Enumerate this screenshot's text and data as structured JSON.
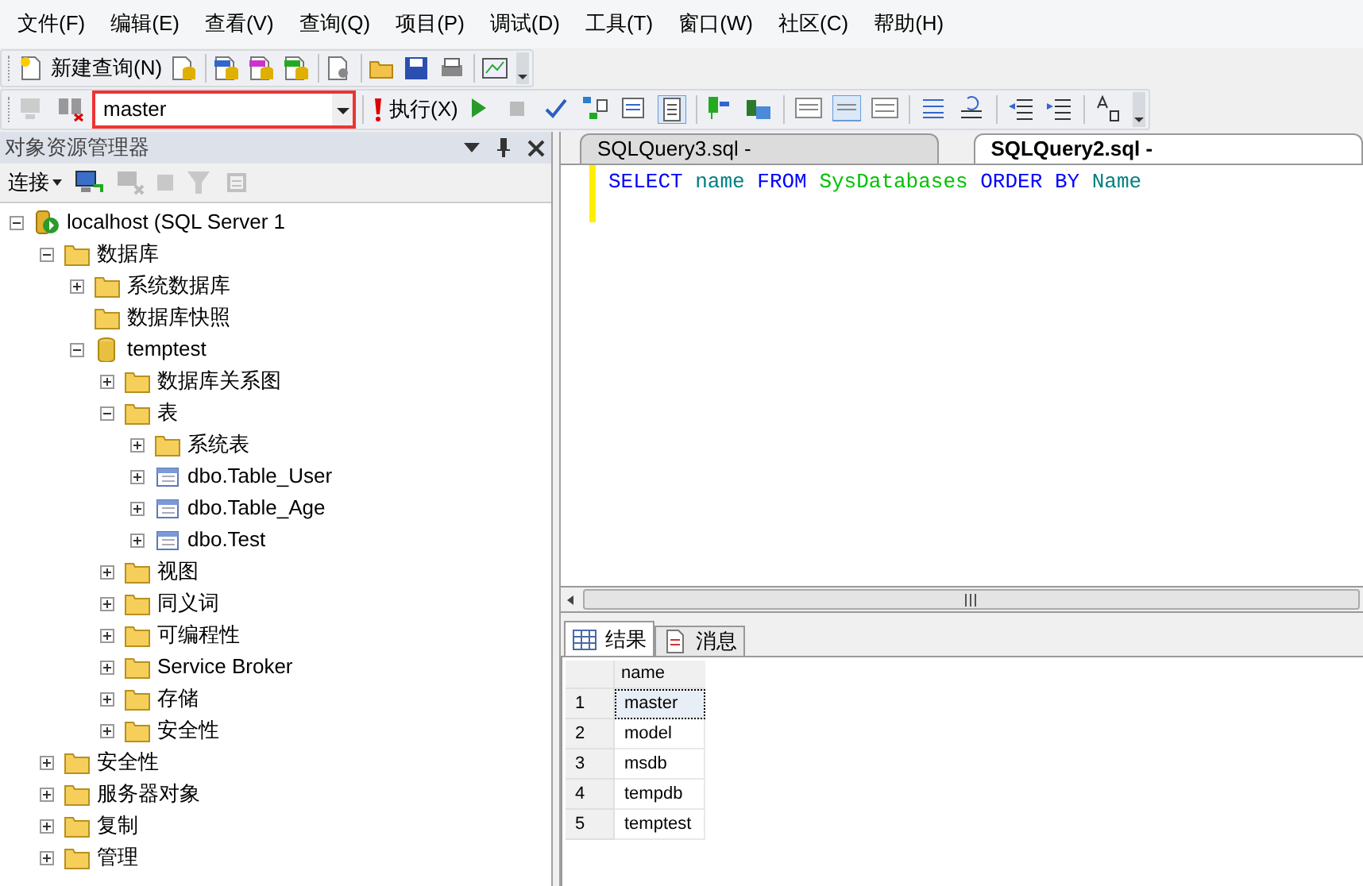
{
  "menu": [
    "文件(F)",
    "编辑(E)",
    "查看(V)",
    "查询(Q)",
    "项目(P)",
    "调试(D)",
    "工具(T)",
    "窗口(W)",
    "社区(C)",
    "帮助(H)"
  ],
  "toolbar": {
    "new_query": "新建查询(N)"
  },
  "sql_toolbar": {
    "database": "master",
    "highlighted": true,
    "execute": "执行(X)"
  },
  "object_explorer": {
    "title": "对象资源管理器",
    "connect": "连接",
    "tree": [
      {
        "label": "localhost (SQL Server 1",
        "kind": "server",
        "expanded": true,
        "children": [
          {
            "label": "数据库",
            "kind": "folder",
            "expanded": true,
            "children": [
              {
                "label": "系统数据库",
                "kind": "folder",
                "expanded": false
              },
              {
                "label": "数据库快照",
                "kind": "folder"
              },
              {
                "label": "temptest",
                "kind": "database",
                "expanded": true,
                "children": [
                  {
                    "label": "数据库关系图",
                    "kind": "folder",
                    "expanded": false
                  },
                  {
                    "label": "表",
                    "kind": "folder",
                    "expanded": true,
                    "children": [
                      {
                        "label": "系统表",
                        "kind": "folder",
                        "expanded": false
                      },
                      {
                        "label": "dbo.Table_User",
                        "kind": "table",
                        "expanded": false
                      },
                      {
                        "label": "dbo.Table_Age",
                        "kind": "table",
                        "expanded": false
                      },
                      {
                        "label": "dbo.Test",
                        "kind": "table",
                        "expanded": false
                      }
                    ]
                  },
                  {
                    "label": "视图",
                    "kind": "folder",
                    "expanded": false
                  },
                  {
                    "label": "同义词",
                    "kind": "folder",
                    "expanded": false
                  },
                  {
                    "label": "可编程性",
                    "kind": "folder",
                    "expanded": false
                  },
                  {
                    "label": "Service Broker",
                    "kind": "folder",
                    "expanded": false
                  },
                  {
                    "label": "存储",
                    "kind": "folder",
                    "expanded": false
                  },
                  {
                    "label": "安全性",
                    "kind": "folder",
                    "expanded": false
                  }
                ]
              }
            ]
          },
          {
            "label": "安全性",
            "kind": "folder",
            "expanded": false
          },
          {
            "label": "服务器对象",
            "kind": "folder",
            "expanded": false
          },
          {
            "label": "复制",
            "kind": "folder",
            "expanded": false
          },
          {
            "label": "管理",
            "kind": "folder",
            "expanded": false
          }
        ]
      }
    ]
  },
  "editor_tabs": [
    {
      "label": "SQLQuery3.sql -",
      "selected": false
    },
    {
      "label": "SQLQuery2.sql -",
      "selected": true
    }
  ],
  "code": [
    {
      "text": "SELECT",
      "kind": "keyword"
    },
    {
      "text": "name",
      "kind": "identifier"
    },
    {
      "text": "FROM",
      "kind": "keyword"
    },
    {
      "text": "SysDatabases",
      "kind": "object"
    },
    {
      "text": "ORDER",
      "kind": "keyword"
    },
    {
      "text": "BY",
      "kind": "keyword"
    },
    {
      "text": "Name",
      "kind": "identifier"
    }
  ],
  "result_tabs": [
    {
      "label": "结果",
      "kind": "grid",
      "selected": true
    },
    {
      "label": "消息",
      "kind": "messages",
      "selected": false
    }
  ],
  "results": {
    "columns": [
      "name"
    ],
    "rows": [
      {
        "number": "1",
        "value": "master",
        "selected": true
      },
      {
        "number": "2",
        "value": "model",
        "selected": false
      },
      {
        "number": "3",
        "value": "msdb",
        "selected": false
      },
      {
        "number": "4",
        "value": "tempdb",
        "selected": false
      },
      {
        "number": "5",
        "value": "temptest",
        "selected": false
      }
    ]
  }
}
